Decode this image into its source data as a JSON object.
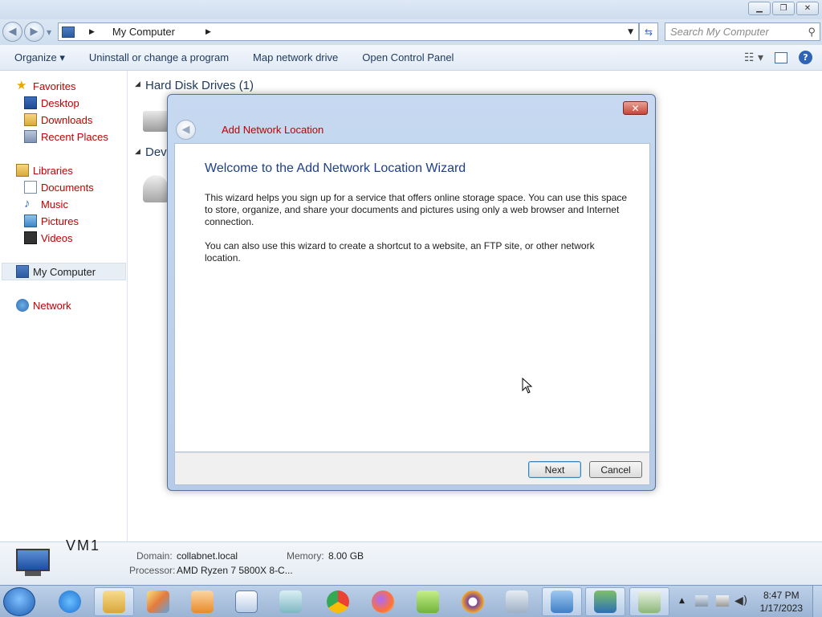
{
  "window": {
    "controls": [
      "minimize",
      "restore",
      "close"
    ]
  },
  "address": {
    "path": "My Computer",
    "search_placeholder": "Search My Computer"
  },
  "commands": {
    "organize": "Organize ▾",
    "uninstall": "Uninstall or change a program",
    "map_drive": "Map network drive",
    "control_panel": "Open Control Panel"
  },
  "nav": {
    "favorites": "Favorites",
    "desktop": "Desktop",
    "downloads": "Downloads",
    "recent": "Recent Places",
    "libraries": "Libraries",
    "documents": "Documents",
    "music": "Music",
    "pictures": "Pictures",
    "videos": "Videos",
    "my_computer": "My Computer",
    "network": "Network"
  },
  "content": {
    "hard_disk_group": "Hard Disk Drives (1)",
    "devices_group_partial": "Dev"
  },
  "details": {
    "partial_name": "VM1",
    "domain_label": "Domain:",
    "domain_value": "collabnet.local",
    "memory_label": "Memory:",
    "memory_value": "8.00 GB",
    "processor_label": "Processor:",
    "processor_value": "AMD Ryzen 7 5800X 8-C..."
  },
  "dialog": {
    "title": "Add Network Location",
    "heading": "Welcome to the Add Network Location Wizard",
    "paragraph1": "This wizard helps you sign up for a service that offers online storage space.  You can use this space to store, organize, and share your documents and pictures using only a web browser and Internet connection.",
    "paragraph2": "You can also use this wizard to create a shortcut to a website, an FTP site, or other network location.",
    "next_label": "Next",
    "cancel_label": "Cancel"
  },
  "taskbar": {
    "apps": [
      "internet-explorer",
      "file-explorer",
      "paint",
      "media-player",
      "wordpad",
      "notepad",
      "chrome",
      "firefox",
      "notepad-plus-plus",
      "tor-browser",
      "calculator",
      "control-panel",
      "remote-desktop",
      "task-manager"
    ],
    "time": "8:47 PM",
    "date": "1/17/2023"
  },
  "colors": {
    "link_red": "#c00000",
    "heading_blue": "#1e3f8a"
  }
}
